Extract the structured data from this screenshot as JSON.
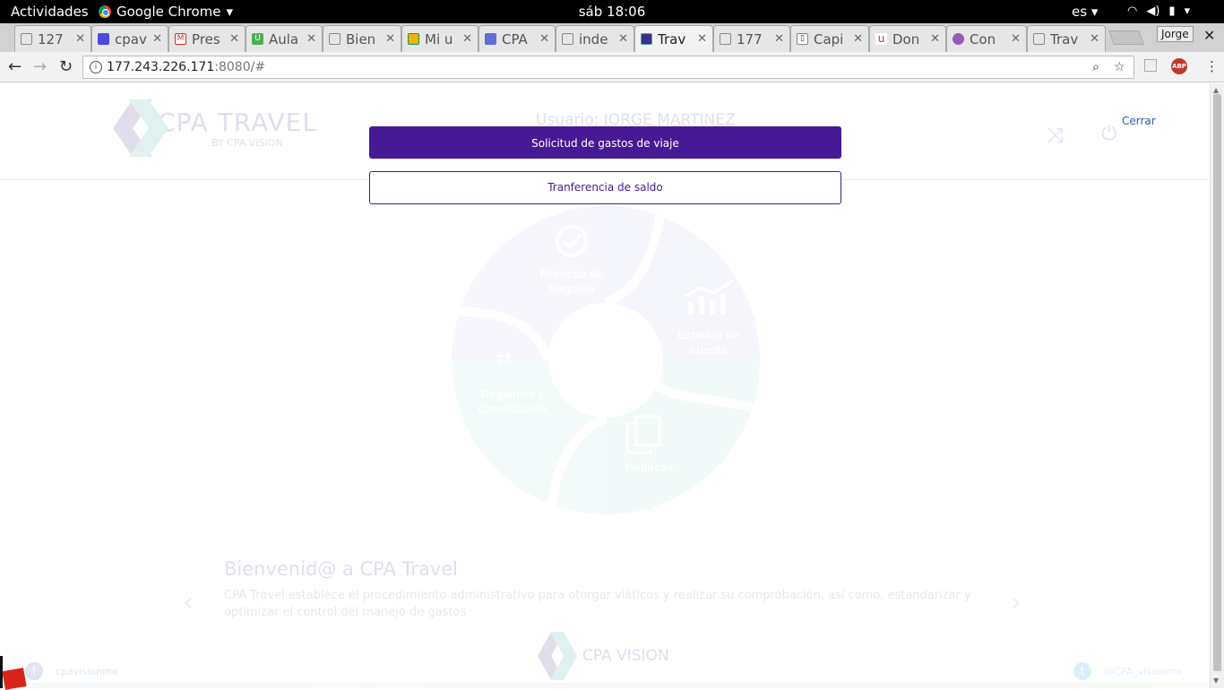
{
  "system_bar": {
    "activities": "Actividades",
    "app_name": "Google Chrome",
    "clock": "sáb 18:06",
    "language": "es"
  },
  "tabs": [
    {
      "label": "127",
      "icon": "drive-warning-icon"
    },
    {
      "label": "cpav",
      "icon": "shield-icon"
    },
    {
      "label": "Pres",
      "icon": "gmail-icon"
    },
    {
      "label": "Aula",
      "icon": "udemy-icon"
    },
    {
      "label": "Bien",
      "icon": "page-icon"
    },
    {
      "label": "Mi u",
      "icon": "drive-icon"
    },
    {
      "label": "CPA",
      "icon": "docs-icon"
    },
    {
      "label": "inde",
      "icon": "page-icon"
    },
    {
      "label": "Trav",
      "icon": "cpa-icon"
    },
    {
      "label": "177",
      "icon": "page-icon"
    },
    {
      "label": "Capi",
      "icon": "book-icon"
    },
    {
      "label": "Don",
      "icon": "udemy-u-icon"
    },
    {
      "label": "Con",
      "icon": "pin-icon"
    },
    {
      "label": "Trav",
      "icon": "page-icon"
    }
  ],
  "profile_name": "Jorge",
  "address_bar": {
    "host": "177.243.226.171",
    "path": ":8080/#"
  },
  "header": {
    "usuario": "Usuario: JORGE MARTINEZ",
    "cerrar": "Cerrar",
    "logo_title": "CPA TRAVEL",
    "logo_sub": "BY CPA VISION"
  },
  "modal": {
    "primary_button": "Solicitud de gastos de viaje",
    "secondary_button": "Tranferencia de saldo"
  },
  "diagram": {
    "segments": [
      {
        "label_1": "Proceso de",
        "label_2": "Negocio"
      },
      {
        "label_1": "Estados de",
        "label_2": "cuenta"
      },
      {
        "label_1": "Políticas",
        "label_2": ""
      },
      {
        "label_1": "Registros y",
        "label_2": "Conciliación"
      }
    ]
  },
  "welcome": {
    "title": "Bienvenid@ a CPA Travel",
    "text": "CPA Travel establece el procedimiento administrativo para otorgar viáticos y realizar su comprobación, así como, estandarizar y optimizar el control del manejo de gastos"
  },
  "footer": {
    "logo_text": "CPA VISION",
    "facebook": "cpavisionmx",
    "twitter": "@CPA_visionmx"
  },
  "colors": {
    "primary": "#461a94",
    "teal": "#3aa8a2",
    "brand_purple": "#3d2f86"
  }
}
